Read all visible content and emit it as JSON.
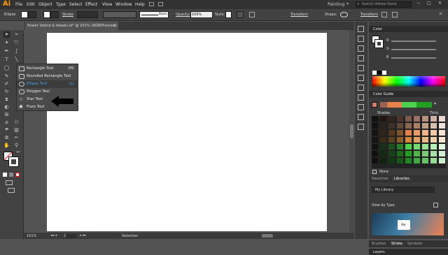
{
  "app": {
    "logo": "Ai"
  },
  "menu": [
    "File",
    "Edit",
    "Object",
    "Type",
    "Select",
    "Effect",
    "View",
    "Window",
    "Help"
  ],
  "workspace": {
    "label": "Painting",
    "search_placeholder": "Search Adobe Stock"
  },
  "control": {
    "object": "Ellipse",
    "stroke_label": "Stroke",
    "brush": "Basic",
    "opacity_label": "Opacity:",
    "opacity_value": "100%",
    "style_label": "Style:",
    "transform_label": "Transform",
    "shape_label": "Shape:",
    "transform2_label": "Transform"
  },
  "document": {
    "tab_title": "flower (blend & tweak).ai* @ 101% (RGB/Preview)"
  },
  "flyout": {
    "items": [
      {
        "label": "Rectangle Tool",
        "key": "(M)"
      },
      {
        "label": "Rounded Rectangle Tool",
        "key": ""
      },
      {
        "label": "Ellipse Tool",
        "key": "(L)"
      },
      {
        "label": "Polygon Tool",
        "key": ""
      },
      {
        "label": "Star Tool",
        "key": ""
      },
      {
        "label": "Flare Tool",
        "key": ""
      }
    ]
  },
  "status": {
    "zoom": "101%",
    "artboard": "2",
    "selection": "Selection"
  },
  "panels": {
    "color": "Color",
    "color_channels": [
      "R",
      "G",
      "B"
    ],
    "color_guide": "Color Guide",
    "shades": "Shades",
    "tints": "Tints",
    "none": "None",
    "swatches_tab": "Swatches",
    "libraries_tab": "Libraries",
    "my_library": "My Library",
    "view_by": "View by Type",
    "library_item": "Aa",
    "brushes_tab": "Brushes",
    "stroke_tab": "Stroke",
    "symbols_tab": "Symbols",
    "layers": "Layers"
  },
  "colors": {
    "accent": "#31a8ff",
    "selected_text": "#4fa3e8",
    "fill": "#ffffff",
    "stroke_line": "#ff0000"
  }
}
